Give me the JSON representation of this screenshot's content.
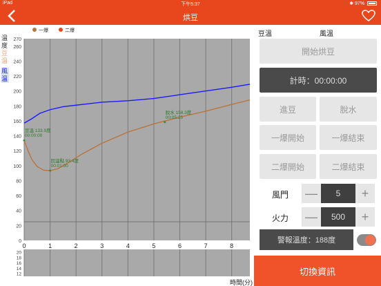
{
  "status": {
    "device": "iPad",
    "time": "下午5:37",
    "battery": "97%"
  },
  "nav": {
    "title": "烘豆"
  },
  "side_labels": {
    "bean_top": "溫",
    "bean_mid": "度",
    "bean_temp": "豆溫",
    "air_temp": "風溫"
  },
  "legend": {
    "first_crack": "一爆",
    "second_crack": "二爆"
  },
  "chart_data": {
    "type": "line",
    "xlabel": "時間(分)",
    "ylabel": "",
    "xlim": [
      0,
      8.7
    ],
    "ylim": [
      0,
      270
    ],
    "x_ticks": [
      0,
      1,
      2,
      3,
      4,
      5,
      6,
      7,
      8
    ],
    "y_ticks": [
      0,
      20,
      40,
      60,
      80,
      100,
      120,
      140,
      160,
      180,
      200,
      220,
      240,
      260,
      270
    ],
    "sub_y_ticks": [
      12,
      14,
      16,
      18,
      20
    ],
    "grid": true,
    "series": [
      {
        "color": "#1a1aff",
        "x": [
          0,
          0.3,
          0.6,
          1,
          1.5,
          2,
          2.5,
          3,
          4,
          5,
          6,
          7,
          8,
          8.7
        ],
        "y": [
          157,
          163,
          170,
          175,
          179,
          181,
          183,
          185,
          187,
          190,
          195,
          200,
          205,
          209
        ]
      },
      {
        "color": "#b8753e",
        "x": [
          0,
          0.15,
          0.3,
          0.5,
          0.75,
          1,
          1.3,
          1.7,
          2.2,
          3,
          4,
          5,
          6,
          7,
          8,
          8.7
        ],
        "y": [
          133.9,
          120,
          108,
          99,
          94,
          93.4,
          96,
          104,
          115,
          130,
          145,
          156,
          165,
          173,
          182,
          188
        ]
      }
    ],
    "annotations": [
      {
        "text": "豆溫 133.9度",
        "sub": "00:00:00",
        "x": 0,
        "y": 133.9
      },
      {
        "text": "回溫點 93.4度",
        "sub": "00:01:00",
        "x": 1,
        "y": 93.4
      },
      {
        "text": "脫水 158.3度",
        "sub": "00:05:25",
        "x": 5.42,
        "y": 158.3
      }
    ],
    "threshold_line": 25
  },
  "panel": {
    "bean_label": "豆溫",
    "air_label": "風溫",
    "start_roast": "開始烘豆",
    "timer": "計時：00:00:00",
    "charge": "進豆",
    "dry": "脫水",
    "fc_start": "一爆開始",
    "fc_end": "一爆結束",
    "sc_start": "二爆開始",
    "sc_end": "二爆結束",
    "damper_label": "風門",
    "damper_value": "5",
    "fire_label": "火力",
    "fire_value": "500",
    "minus": "—",
    "plus": "+",
    "alarm": "警報溫度：188度",
    "switch_info": "切換資訊"
  },
  "colors": {
    "accent": "#e8461c",
    "bean_line": "#b8753e",
    "air_line": "#1a1aff",
    "plot_bg": "#a9a9a9"
  }
}
